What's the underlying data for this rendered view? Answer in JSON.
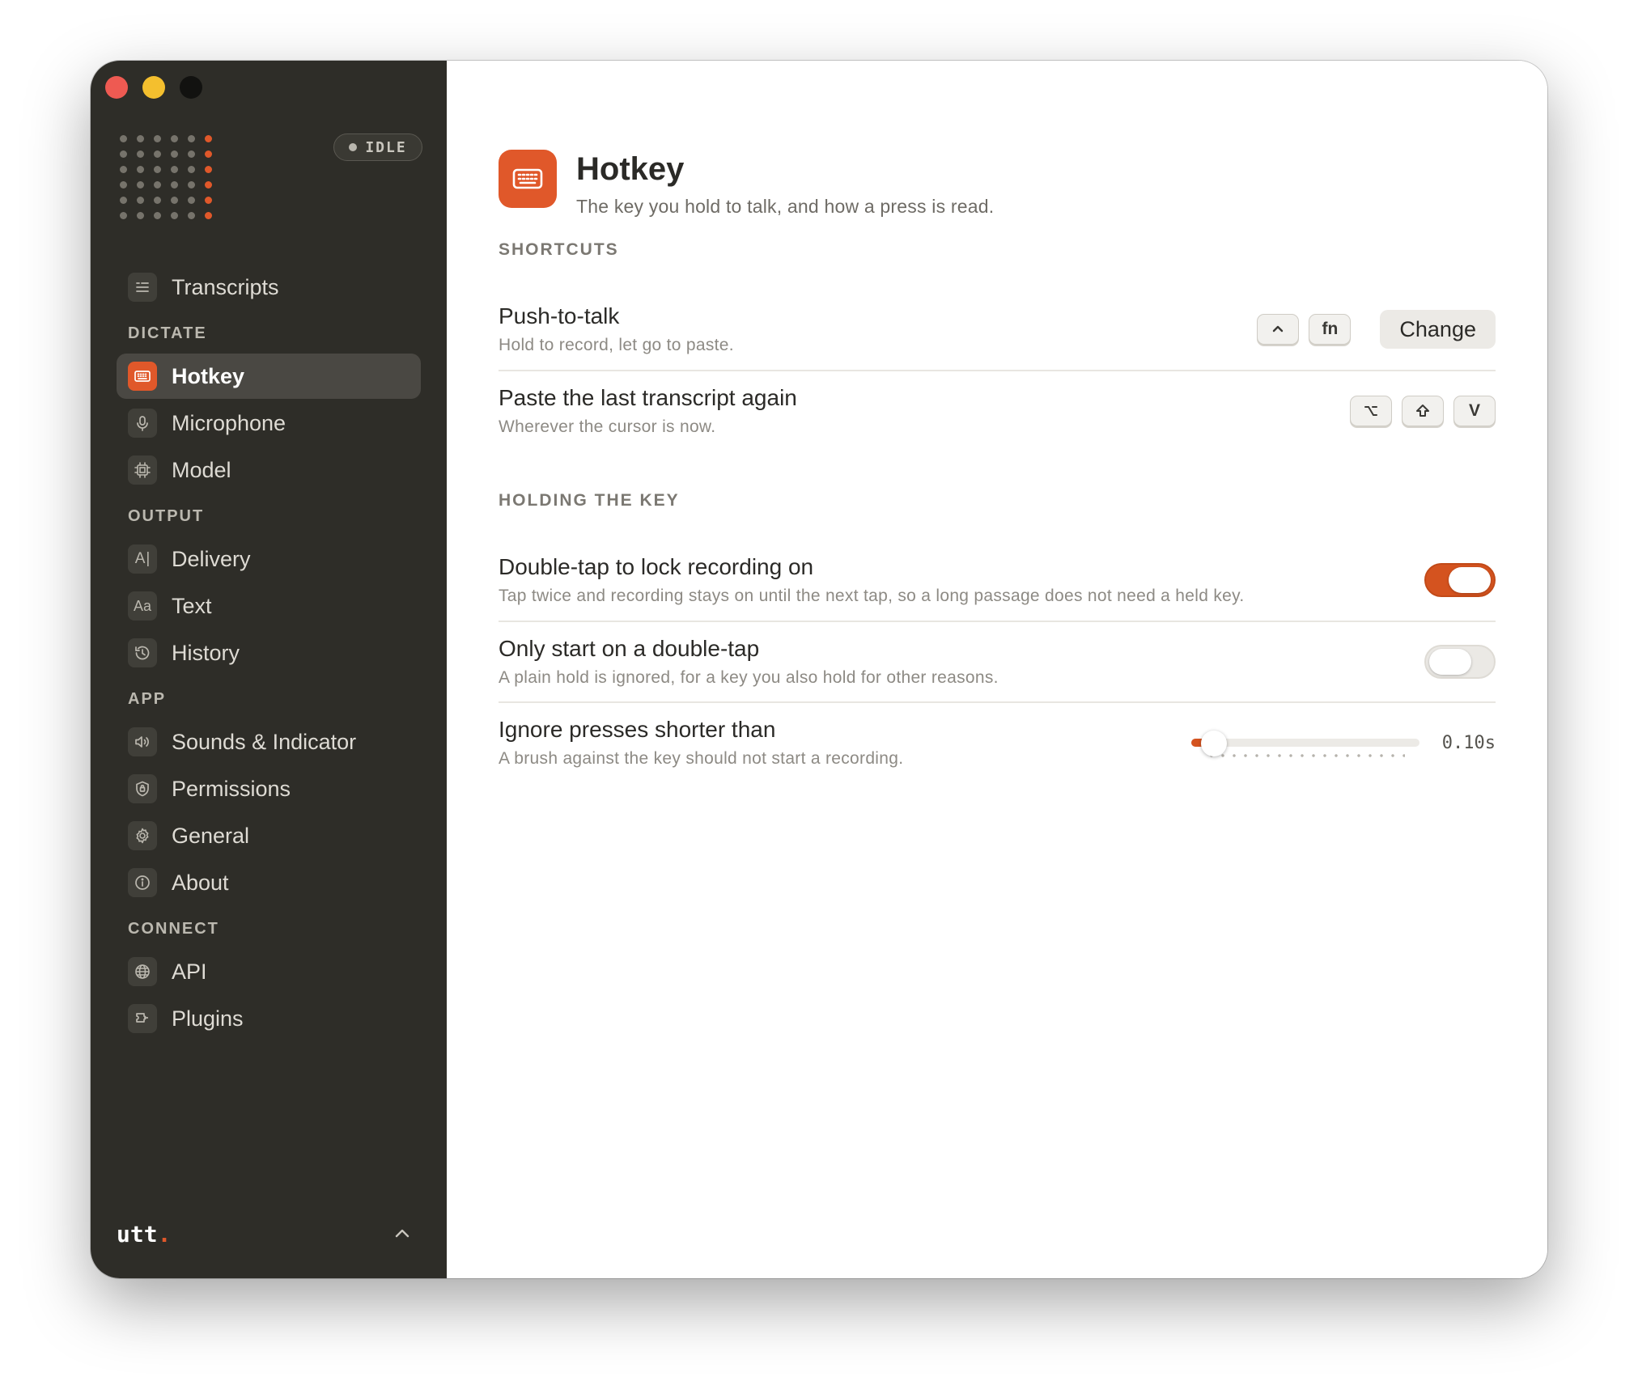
{
  "status": {
    "label": "IDLE"
  },
  "sidebar": {
    "top_item": {
      "label": "Transcripts",
      "icon": "transcripts-icon"
    },
    "sections": [
      {
        "heading": "DICTATE",
        "items": [
          {
            "label": "Hotkey",
            "icon": "keyboard-icon",
            "active": true
          },
          {
            "label": "Microphone",
            "icon": "microphone-icon"
          },
          {
            "label": "Model",
            "icon": "chip-icon"
          }
        ]
      },
      {
        "heading": "OUTPUT",
        "items": [
          {
            "label": "Delivery",
            "icon": "text-cursor-icon"
          },
          {
            "label": "Text",
            "icon": "font-icon"
          },
          {
            "label": "History",
            "icon": "history-icon"
          }
        ]
      },
      {
        "heading": "APP",
        "items": [
          {
            "label": "Sounds & Indicator",
            "icon": "speaker-icon"
          },
          {
            "label": "Permissions",
            "icon": "shield-icon"
          },
          {
            "label": "General",
            "icon": "gear-icon"
          },
          {
            "label": "About",
            "icon": "info-icon"
          }
        ]
      },
      {
        "heading": "CONNECT",
        "items": [
          {
            "label": "API",
            "icon": "globe-icon"
          },
          {
            "label": "Plugins",
            "icon": "plug-icon"
          }
        ]
      }
    ],
    "icon_glyphs": {
      "font": "Aa",
      "text_cursor": "A"
    },
    "brand": "utt",
    "brand_dot": "."
  },
  "page": {
    "title": "Hotkey",
    "subtitle": "The key you hold to talk, and how a press is read."
  },
  "shortcuts": {
    "heading": "SHORTCUTS",
    "push_to_talk": {
      "title": "Push-to-talk",
      "desc": "Hold to record, let go to paste.",
      "keys": [
        "^",
        "fn"
      ],
      "change_label": "Change"
    },
    "paste_again": {
      "title": "Paste the last transcript again",
      "desc": "Wherever the cursor is now.",
      "keys": [
        "⌥",
        "⇧",
        "V"
      ]
    }
  },
  "holding": {
    "heading": "HOLDING THE KEY",
    "double_tap_lock": {
      "title": "Double-tap to lock recording on",
      "desc": "Tap twice and recording stays on until the next tap, so a long passage does not need a held key.",
      "enabled": true
    },
    "only_double_tap": {
      "title": "Only start on a double-tap",
      "desc": "A plain hold is ignored, for a key you also hold for other reasons.",
      "enabled": false
    },
    "ignore_short": {
      "title": "Ignore presses shorter than",
      "desc": "A brush against the key should not start a recording.",
      "value_label": "0.10s",
      "fraction": 0.1
    }
  },
  "colors": {
    "accent": "#e0582a",
    "sidebar_bg": "#2e2d28"
  }
}
